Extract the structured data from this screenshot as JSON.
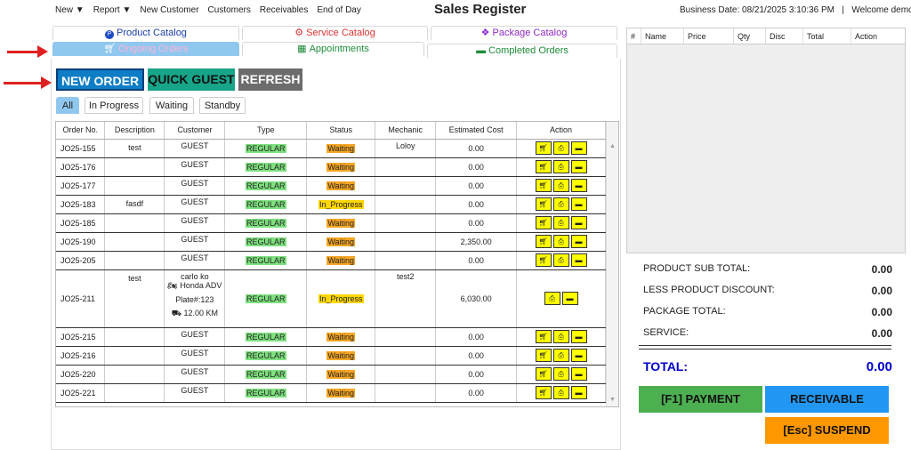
{
  "nav": {
    "items": [
      "New ▼",
      "Report ▼",
      "New Customer",
      "Customers",
      "Receivables",
      "End of Day"
    ]
  },
  "header": {
    "title": "Sales Register",
    "business_date": "Business Date: 08/21/2025 3:10:36 PM",
    "separator": "|",
    "welcome": "Welcome demo ▼"
  },
  "tabs": {
    "product_catalog": "Product Catalog",
    "service_catalog": "Service Catalog",
    "package_catalog": "Package Catalog",
    "ongoing_orders": "Ongoing Orders",
    "appointments": "Appointments",
    "completed_orders": "Completed Orders"
  },
  "buttons": {
    "new_order": "NEW ORDER",
    "quick_guest": "QUICK GUEST",
    "refresh": "REFRESH"
  },
  "filters": [
    "All",
    "In Progress",
    "Waiting",
    "Standby"
  ],
  "table": {
    "headers": [
      "Order No.",
      "Description",
      "Customer",
      "Type",
      "Status",
      "Mechanic",
      "Estimated Cost",
      "Action"
    ],
    "rows": [
      {
        "order": "JO25-155",
        "desc": "test",
        "cust": "GUEST",
        "type": "REGULAR",
        "status": "Waiting",
        "mech": "Loloy",
        "cost": "0.00"
      },
      {
        "order": "JO25-176",
        "desc": "",
        "cust": "GUEST",
        "type": "REGULAR",
        "status": "Waiting",
        "mech": "",
        "cost": "0.00"
      },
      {
        "order": "JO25-177",
        "desc": "",
        "cust": "GUEST",
        "type": "REGULAR",
        "status": "Waiting",
        "mech": "",
        "cost": "0.00"
      },
      {
        "order": "JO25-183",
        "desc": "fasdf",
        "cust": "GUEST",
        "type": "REGULAR",
        "status": "In_Progress",
        "mech": "",
        "cost": "0.00"
      },
      {
        "order": "JO25-185",
        "desc": "",
        "cust": "GUEST",
        "type": "REGULAR",
        "status": "Waiting",
        "mech": "",
        "cost": "0.00"
      },
      {
        "order": "JO25-190",
        "desc": "",
        "cust": "GUEST",
        "type": "REGULAR",
        "status": "Waiting",
        "mech": "",
        "cost": "2,350.00"
      },
      {
        "order": "JO25-205",
        "desc": "",
        "cust": "GUEST",
        "type": "REGULAR",
        "status": "Waiting",
        "mech": "",
        "cost": "0.00"
      },
      {
        "order": "JO25-211",
        "desc": "test",
        "cust": "carlo ko",
        "cust2": "Honda ADV",
        "cust3": "Plate#:123",
        "cust4": "12.00 KM",
        "type": "REGULAR",
        "status": "In_Progress",
        "mech": "test2",
        "cost": "6,030.00"
      },
      {
        "order": "JO25-215",
        "desc": "",
        "cust": "GUEST",
        "type": "REGULAR",
        "status": "Waiting",
        "mech": "",
        "cost": "0.00"
      },
      {
        "order": "JO25-216",
        "desc": "",
        "cust": "GUEST",
        "type": "REGULAR",
        "status": "Waiting",
        "mech": "",
        "cost": "0.00"
      },
      {
        "order": "JO25-220",
        "desc": "",
        "cust": "GUEST",
        "type": "REGULAR",
        "status": "Waiting",
        "mech": "",
        "cost": "0.00"
      },
      {
        "order": "JO25-221",
        "desc": "",
        "cust": "GUEST",
        "type": "REGULAR",
        "status": "Waiting",
        "mech": "",
        "cost": "0.00"
      }
    ]
  },
  "cart": {
    "headers": [
      "#",
      "Name",
      "Price",
      "Qty",
      "Disc",
      "Total",
      "Action"
    ]
  },
  "summary": {
    "product_sub_total_label": "PRODUCT SUB TOTAL:",
    "product_sub_total": "0.00",
    "less_discount_label": "LESS PRODUCT DISCOUNT:",
    "less_discount": "0.00",
    "package_total_label": "PACKAGE TOTAL:",
    "package_total": "0.00",
    "service_label": "SERVICE:",
    "service": "0.00",
    "total_label": "TOTAL:",
    "total": "0.00"
  },
  "pay": {
    "payment": "[F1] PAYMENT",
    "receivable": "RECEIVABLE",
    "suspend": "[Esc] SUSPEND"
  },
  "colors": {
    "new_order": "#0d7dc6",
    "quick_guest": "#17a589",
    "refresh": "#6c6c6c",
    "payment": "#4caf50",
    "receivable": "#2196f3",
    "suspend": "#ff9800",
    "tab_active": "#90c7ef",
    "total": "#0000cc"
  }
}
